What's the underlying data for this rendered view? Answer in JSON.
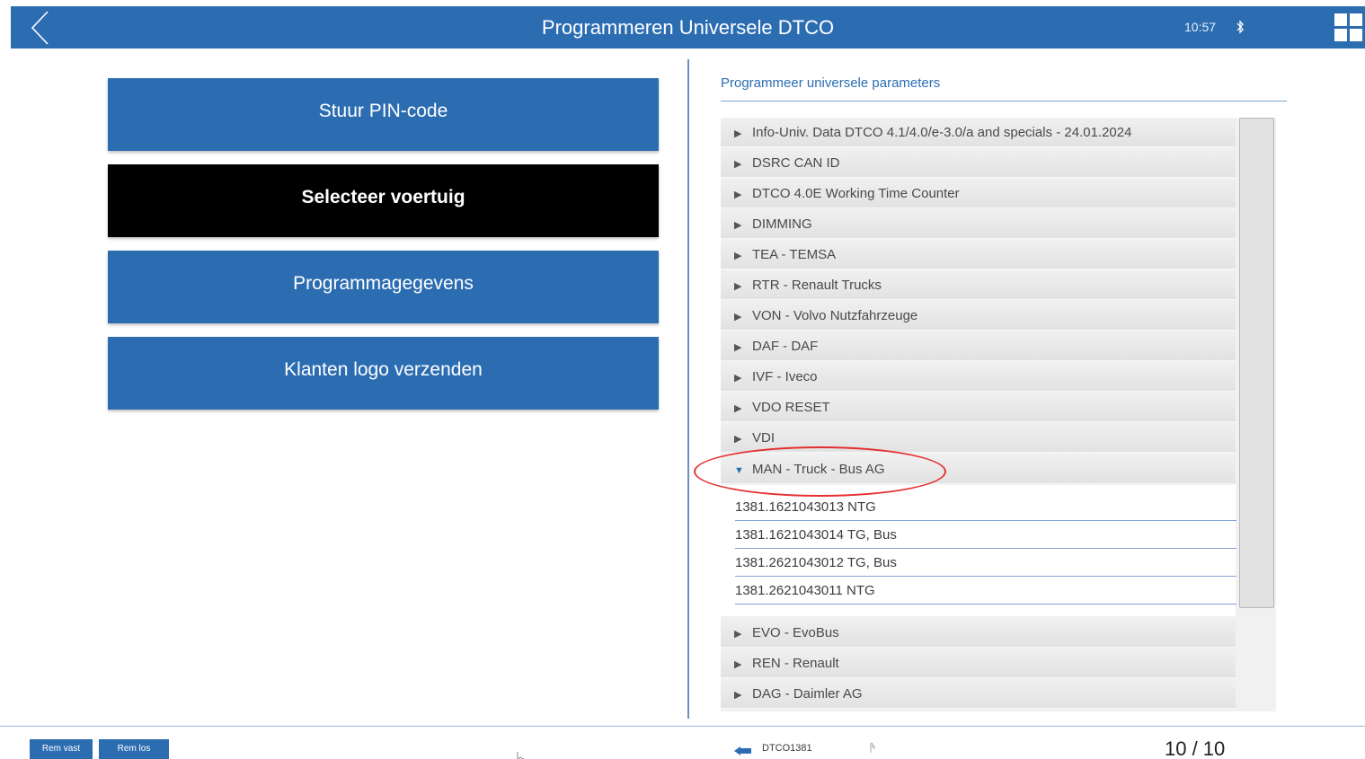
{
  "header": {
    "title": "Programmeren Universele DTCO",
    "time": "10:57"
  },
  "menu": {
    "buttons": [
      {
        "label": "Stuur PIN-code",
        "active": false
      },
      {
        "label": "Selecteer voertuig",
        "active": true
      },
      {
        "label": "Programmagegevens",
        "active": false
      },
      {
        "label": "Klanten logo verzenden",
        "active": false
      }
    ]
  },
  "panel": {
    "title": "Programmeer universele parameters",
    "items_top": [
      "Info-Univ. Data DTCO 4.1/4.0/e-3.0/a and specials - 24.01.2024",
      "DSRC CAN ID",
      "DTCO 4.0E Working Time Counter",
      "DIMMING",
      "TEA - TEMSA",
      "RTR - Renault Trucks",
      "VON - Volvo Nutzfahrzeuge",
      "DAF - DAF",
      "IVF - Iveco",
      "VDO RESET",
      "VDI"
    ],
    "expanded_item": "MAN - Truck - Bus AG",
    "sub_items": [
      "1381.1621043013 NTG",
      "1381.1621043014 TG, Bus",
      "1381.2621043012 TG, Bus",
      "1381.2621043011 NTG"
    ],
    "items_bottom": [
      "EVO - EvoBus",
      "REN - Renault",
      "DAG - Daimler AG"
    ],
    "colors": {
      "accent": "#2c6db2",
      "highlight": "#e53030"
    }
  },
  "footer": {
    "btn_rem_vast": "Rem vast",
    "btn_rem_los": "Rem los",
    "device": "DTCO1381",
    "page": "10 / 10"
  }
}
